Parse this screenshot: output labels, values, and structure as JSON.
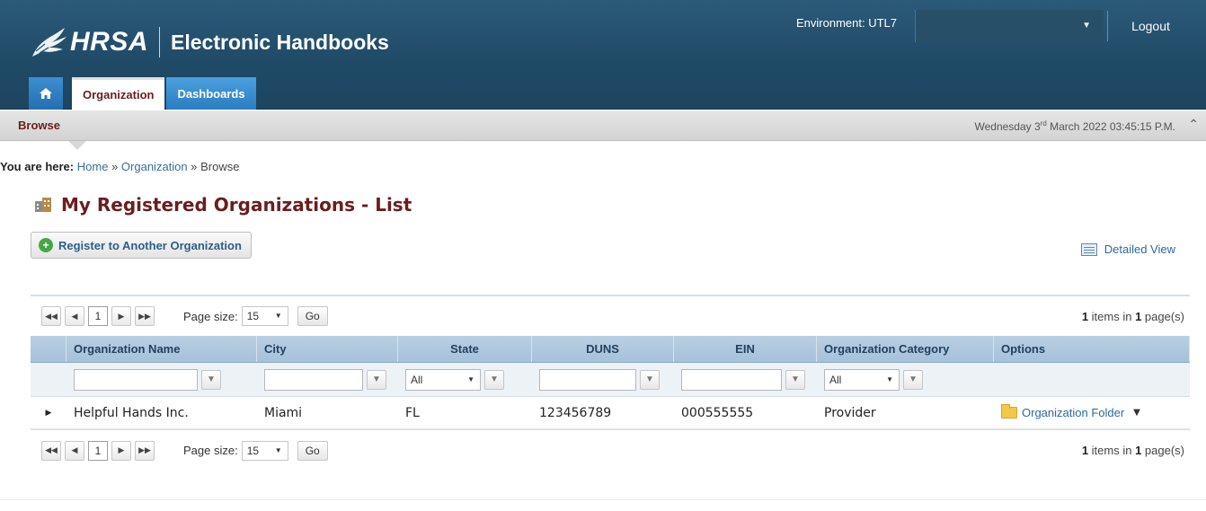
{
  "header": {
    "brand": "HRSA",
    "app_title": "Electronic Handbooks",
    "environment": "Environment: UTL7",
    "logout_label": "Logout",
    "colors": {
      "header_bg": "#1f4a66",
      "accent_tab": "#2a7dc0",
      "title_maroon": "#6b1d1d"
    }
  },
  "tabs": {
    "home_icon": "home-icon",
    "items": [
      {
        "label": "Organization"
      },
      {
        "label": "Dashboards"
      }
    ]
  },
  "subbar": {
    "section": "Browse",
    "date_prefix": "Wednesday 3",
    "date_sup": "rd",
    "date_suffix": " March 2022 03:45:15 P.M."
  },
  "breadcrumb": {
    "lead": "You are here:",
    "items": [
      "Home",
      "Organization",
      "Browse"
    ],
    "sep": "»"
  },
  "page": {
    "title": "My Registered Organizations - List",
    "register_button": "Register to Another Organization",
    "detailed_view": "Detailed View"
  },
  "grid": {
    "pager": {
      "current_page": "1",
      "page_size_label": "Page size:",
      "page_size": "15",
      "go_label": "Go",
      "info_count": "1",
      "info_mid": " items in ",
      "info_pages": "1",
      "info_tail": " page(s)"
    },
    "columns": [
      "Organization Name",
      "City",
      "State",
      "DUNS",
      "EIN",
      "Organization Category",
      "Options"
    ],
    "filters": {
      "state_value": "All",
      "category_value": "All"
    },
    "rows": [
      {
        "name": "Helpful Hands Inc.",
        "city": "Miami",
        "state": "FL",
        "duns": "123456789",
        "ein": "000555555",
        "category": "Provider",
        "option": "Organization Folder"
      }
    ]
  }
}
